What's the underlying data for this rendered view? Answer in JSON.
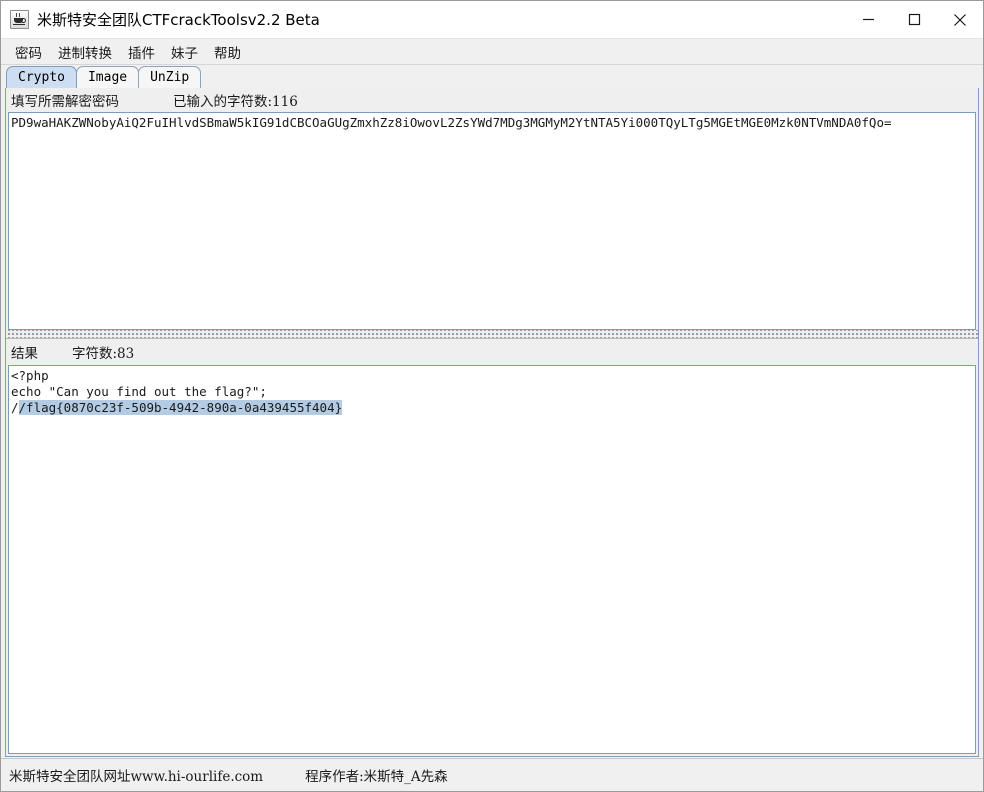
{
  "window": {
    "title": "米斯特安全团队CTFcrackToolsv2.2 Beta",
    "app_icon": "java-cup-icon",
    "controls": {
      "minimize": "minimize-icon",
      "maximize": "maximize-icon",
      "close": "close-icon"
    }
  },
  "menubar": {
    "items": [
      {
        "label": "密码"
      },
      {
        "label": "进制转换"
      },
      {
        "label": "插件"
      },
      {
        "label": "妹子"
      },
      {
        "label": "帮助"
      }
    ]
  },
  "tabs": {
    "selected": "Crypto",
    "items": [
      {
        "label": "Crypto"
      },
      {
        "label": "Image"
      },
      {
        "label": "UnZip"
      }
    ]
  },
  "input_panel": {
    "label": "填写所需解密密码",
    "char_count_label": "已输入的字符数:116",
    "value": "PD9waHAKZWNobyAiQ2FuIHlvdSBmaW5kIG91dCBCOaGUgZmxhZz8iOwovL2ZsYWd7MDg3MGMyM2YtNTA5Yi000TQyLTg5MGEtMGE0Mzk0NTVmNDA0fQo="
  },
  "result_panel": {
    "label": "结果",
    "char_count_label": "字符数:83",
    "lines": [
      {
        "text": "<?php",
        "highlight": ""
      },
      {
        "text": "echo \"Can you find out the flag?\";",
        "highlight": ""
      },
      {
        "text": "/",
        "highlight": "/flag{0870c23f-509b-4942-890a-0a439455f404}"
      }
    ]
  },
  "statusbar": {
    "site": "米斯特安全团队网址www.hi-ourlife.com",
    "author": "程序作者:米斯特_A先森"
  },
  "colors": {
    "tab_selected": "#cddef2",
    "panel_border": "#7d9ec0",
    "selection": "#b4cbe4",
    "window_bg": "#f0f0f0"
  }
}
